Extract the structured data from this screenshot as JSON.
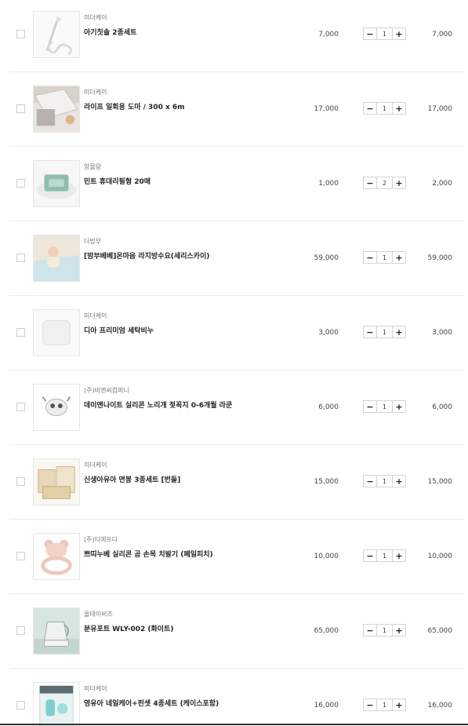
{
  "cart": {
    "items": [
      {
        "brand": "미더케이",
        "name": "아기칫솔 2종세트",
        "price": "7,000",
        "qty": "1",
        "total": "7,000",
        "thumb_icon": "toothbrush-icon"
      },
      {
        "brand": "미더케이",
        "name": "라이프 일회용 도마 / 300 x 6m",
        "price": "17,000",
        "qty": "1",
        "total": "17,000",
        "thumb_icon": "cutting-sheet-icon"
      },
      {
        "brand": "양물랑",
        "name": "민트 휴대리필형 20매",
        "price": "1,000",
        "qty": "2",
        "total": "2,000",
        "thumb_icon": "wipes-pack-icon"
      },
      {
        "brand": "더밤부",
        "name": "[밤부베베]온마음 라지방수요(세리스카이)",
        "price": "59,000",
        "qty": "1",
        "total": "59,000",
        "thumb_icon": "baby-mat-icon"
      },
      {
        "brand": "미더케이",
        "name": "디아 프리미엄 세탁비누",
        "price": "3,000",
        "qty": "1",
        "total": "3,000",
        "thumb_icon": "soap-bar-icon"
      },
      {
        "brand": "(주)비앤씨컴퍼니",
        "name": "데이앤나이트 실리콘 노리개 젖꼭지 0-6개월 라쿤",
        "price": "6,000",
        "qty": "1",
        "total": "6,000",
        "thumb_icon": "pacifier-icon"
      },
      {
        "brand": "미더케이",
        "name": "신생아유아 면봉 3종세트 [번들]",
        "price": "15,000",
        "qty": "1",
        "total": "15,000",
        "thumb_icon": "cotton-swab-box-icon"
      },
      {
        "brand": "(주)티에프디",
        "name": "쁘띠누베 실리콘 곰 손목 치발기 (페일피치)",
        "price": "10,000",
        "qty": "1",
        "total": "10,000",
        "thumb_icon": "bear-teether-icon"
      },
      {
        "brand": "올데이비즈",
        "name": "분유포트 WLY-002 (화이트)",
        "price": "65,000",
        "qty": "1",
        "total": "65,000",
        "thumb_icon": "kettle-icon"
      },
      {
        "brand": "미더케이",
        "name": "영유아 네일케어+핀셋 4종세트 (케이스포함)",
        "price": "16,000",
        "qty": "1",
        "total": "16,000",
        "thumb_icon": "nail-care-set-icon"
      }
    ],
    "minus_symbol": "−",
    "plus_symbol": "+",
    "colors": {
      "border": "#d4d4d4",
      "divider": "#ececec",
      "text": "#222222",
      "muted": "#777777"
    }
  }
}
